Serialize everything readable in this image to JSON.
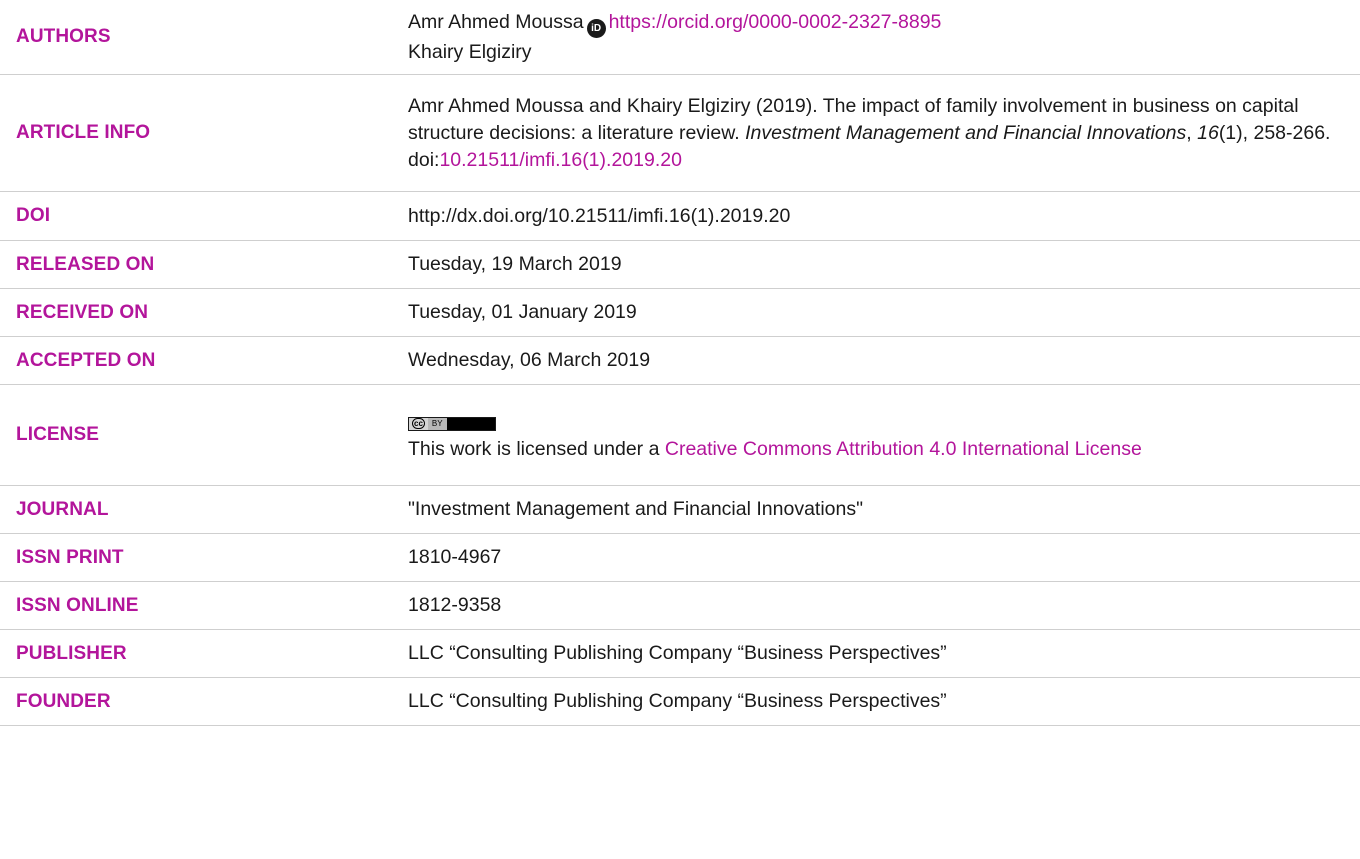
{
  "rows": {
    "authors": {
      "label": "AUTHORS",
      "author1": "Amr Ahmed Moussa",
      "orcid_url": "https://orcid.org/0000-0002-2327-8895",
      "author2": "Khairy Elgiziry"
    },
    "article_info": {
      "label": "ARTICLE INFO",
      "citation_text": "Amr Ahmed Moussa and Khairy Elgiziry (2019). The impact of family involvement in business on capital structure decisions: a literature review.",
      "journal_name": "Investment Management and Financial Innovations",
      "volume": "16",
      "issue_pages": "(1), 258-266.",
      "doi_prefix": "doi:",
      "doi_link": "10.21511/imfi.16(1).2019.20"
    },
    "doi": {
      "label": "DOI",
      "value": "http://dx.doi.org/10.21511/imfi.16(1).2019.20"
    },
    "released_on": {
      "label": "RELEASED ON",
      "value": "Tuesday, 19 March 2019"
    },
    "received_on": {
      "label": "RECEIVED ON",
      "value": "Tuesday, 01 January 2019"
    },
    "accepted_on": {
      "label": "ACCEPTED ON",
      "value": "Wednesday, 06 March 2019"
    },
    "license": {
      "label": "LICENSE",
      "badge_cc": "cc",
      "badge_by": "BY",
      "text": "This work is licensed under a ",
      "link": "Creative Commons Attribution 4.0 International License"
    },
    "journal": {
      "label": "JOURNAL",
      "value": "\"Investment Management and Financial Innovations\""
    },
    "issn_print": {
      "label": "ISSN PRINT",
      "value": "1810-4967"
    },
    "issn_online": {
      "label": "ISSN ONLINE",
      "value": "1812-9358"
    },
    "publisher": {
      "label": "PUBLISHER",
      "value": "LLC “Consulting Publishing Company “Business Perspectives”"
    },
    "founder": {
      "label": "FOUNDER",
      "value": "LLC “Consulting Publishing Company “Business Perspectives”"
    }
  },
  "colors": {
    "label": "#b3159b",
    "link": "#b3159b",
    "text": "#1a1a1a",
    "divider": "#cfcfcf"
  },
  "icons": {
    "orcid": "orcid-icon",
    "license_badge": "cc-by-badge"
  }
}
